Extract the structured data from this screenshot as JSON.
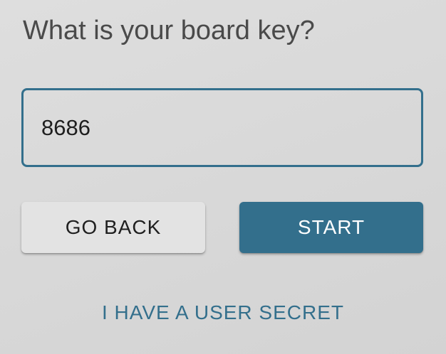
{
  "prompt": {
    "title": "What is your board key?"
  },
  "board_key_input": {
    "value": "8686",
    "placeholder": ""
  },
  "buttons": {
    "go_back": "GO BACK",
    "start": "START"
  },
  "links": {
    "user_secret": "I HAVE A USER SECRET"
  },
  "colors": {
    "accent": "#336f8c",
    "background": "#d8d8d8",
    "secondary_button": "#e3e3e3",
    "text": "#4a4a4a"
  }
}
